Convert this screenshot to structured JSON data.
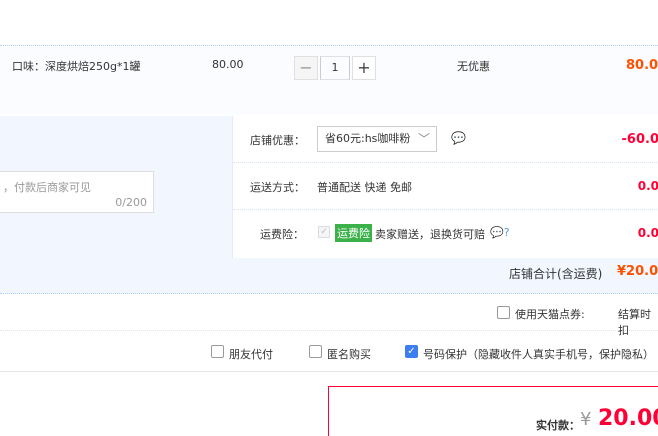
{
  "item": {
    "name": "口味：深度烘焙250g*1罐",
    "unit_price": "80.00",
    "quantity": "1",
    "minus": "−",
    "plus": "+",
    "discount": "无优惠",
    "total": "80.0"
  },
  "message": {
    "placeholder": "，付款后商家可见",
    "count": "0/200"
  },
  "shop_discount": {
    "label": "店铺优惠：",
    "selected": "省60元:hs咖啡粉",
    "amount": "-60.0",
    "arrow": "﹀",
    "icon": "💬"
  },
  "shipping": {
    "label": "运送方式：",
    "value": "普通配送 快递 免邮",
    "amount": "0.0"
  },
  "insurance": {
    "label": "运费险：",
    "badge": "运费险",
    "text": "卖家赠送，退换货可赔",
    "icons": "💬?",
    "amount": "0.0"
  },
  "shop_total": {
    "label": "店铺合计(含运费)",
    "amount": "¥20.0"
  },
  "redeem": {
    "label": "使用天猫点券:",
    "settle": "结算时扣"
  },
  "order_options": [
    {
      "label": "朋友代付",
      "checked": false
    },
    {
      "label": "匿名购买",
      "checked": false
    },
    {
      "label": "号码保护（隐藏收件人真实手机号，保护隐私）",
      "checked": true
    }
  ],
  "payment": {
    "label": "实付款：",
    "currency": "¥",
    "amount": "20.00"
  },
  "colors": {
    "accent": "#ff5000",
    "price_red": "#ff0036",
    "panel_bg": "#f2f7ff",
    "badge_green": "#3bb14a"
  }
}
